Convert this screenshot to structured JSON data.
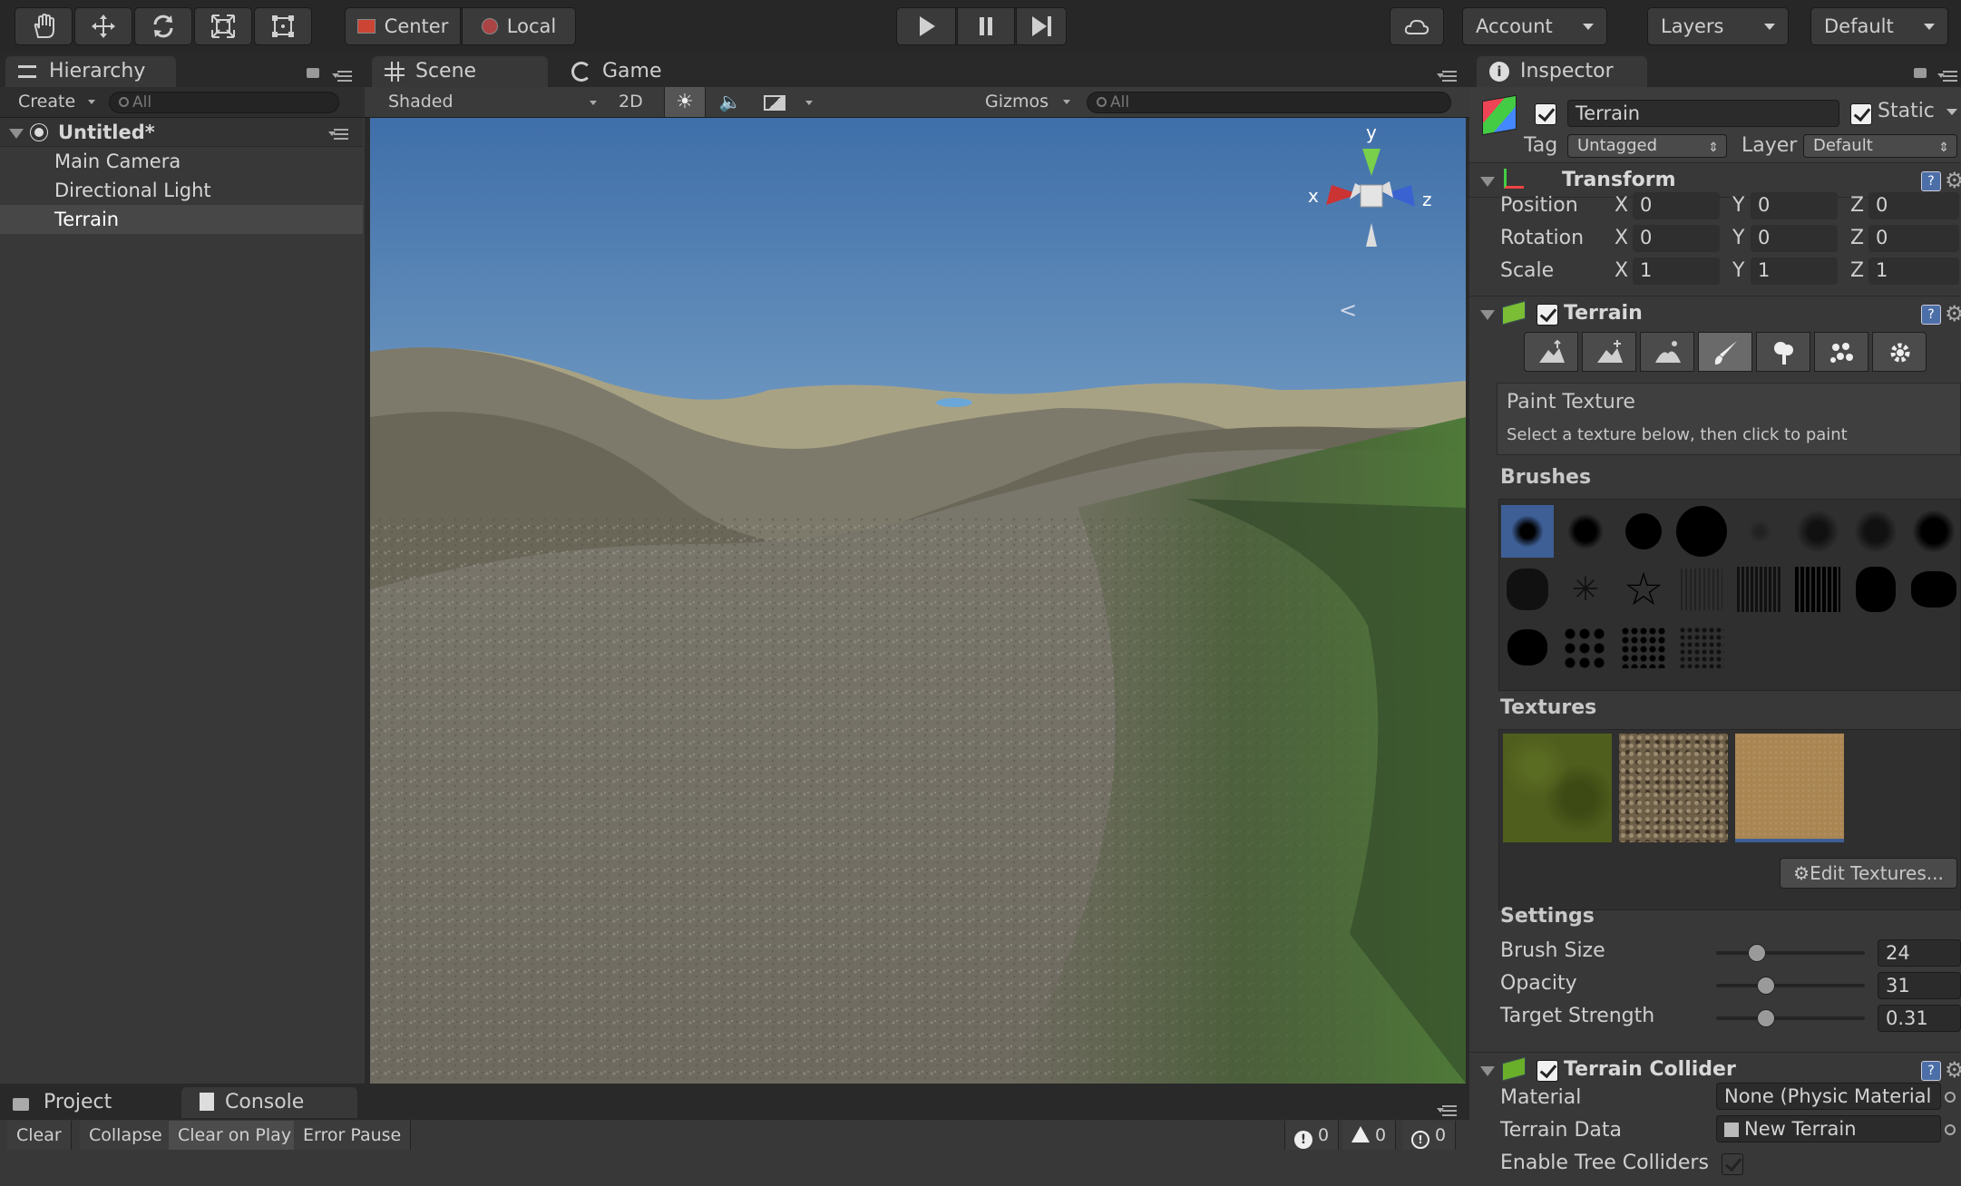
{
  "toolbar": {
    "pivot_center": "Center",
    "pivot_local": "Local",
    "account": "Account",
    "layers": "Layers",
    "layout": "Default"
  },
  "hierarchy": {
    "tab": "Hierarchy",
    "create": "Create",
    "search_placeholder": "All",
    "scene_name": "Untitled*",
    "items": [
      "Main Camera",
      "Directional Light",
      "Terrain"
    ],
    "selected": "Terrain"
  },
  "scene": {
    "tab_scene": "Scene",
    "tab_game": "Game",
    "shading": "Shaded",
    "mode_2d": "2D",
    "gizmos": "Gizmos",
    "search_placeholder": "All",
    "axis_x": "x",
    "axis_y": "y",
    "axis_z": "z"
  },
  "inspector": {
    "tab": "Inspector",
    "object_name": "Terrain",
    "static_label": "Static",
    "tag_label": "Tag",
    "tag_value": "Untagged",
    "layer_label": "Layer",
    "layer_value": "Default",
    "transform": {
      "title": "Transform",
      "rows": [
        {
          "label": "Position",
          "x": "0",
          "y": "0",
          "z": "0"
        },
        {
          "label": "Rotation",
          "x": "0",
          "y": "0",
          "z": "0"
        },
        {
          "label": "Scale",
          "x": "1",
          "y": "1",
          "z": "1"
        }
      ],
      "axis_x": "X",
      "axis_y": "Y",
      "axis_z": "Z"
    },
    "terrain": {
      "title": "Terrain",
      "paint_title": "Paint Texture",
      "paint_hint": "Select a texture below, then click to paint",
      "brushes_label": "Brushes",
      "textures_label": "Textures",
      "edit_textures": "Edit Textures...",
      "settings_label": "Settings",
      "settings": [
        {
          "label": "Brush Size",
          "value": "24",
          "fraction": 0.24
        },
        {
          "label": "Opacity",
          "value": "31",
          "fraction": 0.31
        },
        {
          "label": "Target Strength",
          "value": "0.31",
          "fraction": 0.31
        }
      ]
    },
    "collider": {
      "title": "Terrain Collider",
      "material_label": "Material",
      "material_value": "None (Physic Material",
      "data_label": "Terrain Data",
      "data_value": "New Terrain",
      "trees_label": "Enable Tree Colliders"
    }
  },
  "console": {
    "tab_project": "Project",
    "tab_console": "Console",
    "clear": "Clear",
    "collapse": "Collapse",
    "clear_on_play": "Clear on Play",
    "error_pause": "Error Pause",
    "count_errors": "0",
    "count_warnings": "0",
    "count_messages": "0"
  },
  "colors": {
    "selection": "#4a4a4a",
    "accent_blue": "#3e5f96"
  }
}
